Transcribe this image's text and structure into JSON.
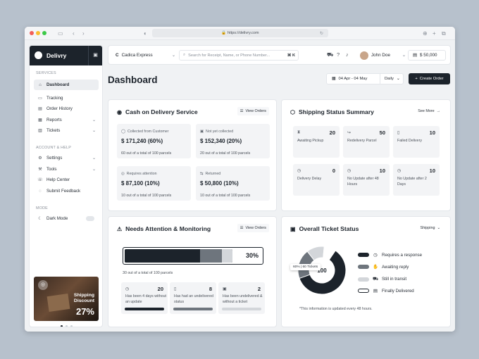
{
  "browser": {
    "url": "https://delivry.com"
  },
  "sidebar": {
    "brand": "Delivry",
    "sections": {
      "services": "SERVICES",
      "account": "ACCOUNT & HELP",
      "mode": "MODE"
    },
    "items": [
      {
        "label": "Dashboard",
        "icon": "home-icon"
      },
      {
        "label": "Tracking",
        "icon": "truck-icon"
      },
      {
        "label": "Order History",
        "icon": "clipboard-icon"
      },
      {
        "label": "Reports",
        "icon": "report-icon"
      },
      {
        "label": "Tickets",
        "icon": "ticket-icon"
      }
    ],
    "account_items": [
      {
        "label": "Settings",
        "icon": "gear-icon"
      },
      {
        "label": "Tools",
        "icon": "tools-icon"
      },
      {
        "label": "Help Center",
        "icon": "help-icon"
      },
      {
        "label": "Submit Feedback",
        "icon": "feedback-icon"
      }
    ],
    "mode_item": "Dark Mode",
    "promo": {
      "line1": "Shipping Discount",
      "line2": "27%"
    }
  },
  "topbar": {
    "company": "Cadica Express",
    "search_placeholder": "Search for Receipt, Name, or Phone Number...",
    "search_shortcut": "⌘ K",
    "user": "John Doe",
    "balance": "$ 50,000"
  },
  "page": {
    "title": "Dashboard",
    "date_range": "04 Apr - 04 May",
    "period": "Daily",
    "create_label": "Create Order"
  },
  "cod": {
    "title": "Cash on Delivery Service",
    "button": "View Orders",
    "tiles": [
      {
        "label": "Collected from Customer",
        "value": "$ 171,240 (60%)",
        "sub": "60 out of a total of 100 parcels"
      },
      {
        "label": "Not yet collected",
        "value": "$ 152,340 (20%)",
        "sub": "20 out of a total of 100 parcels"
      },
      {
        "label": "Requires attention",
        "value": "$ 87,100 (10%)",
        "sub": "10 out of a total of 100 parcels"
      },
      {
        "label": "Returned",
        "value": "$ 50,800 (10%)",
        "sub": "10 out of a total of 100 parcels"
      }
    ]
  },
  "shipping": {
    "title": "Shipping Status Summary",
    "button": "See More",
    "tiles": [
      {
        "count": "20",
        "label": "Awaiting Pickup"
      },
      {
        "count": "50",
        "label": "Redelivery Parcel"
      },
      {
        "count": "10",
        "label": "Failed Delivery"
      },
      {
        "count": "0",
        "label": "Delivery Delay"
      },
      {
        "count": "10",
        "label": "No Update after 48 Hours"
      },
      {
        "count": "10",
        "label": "No Update after 2 Days"
      }
    ]
  },
  "attention": {
    "title": "Needs Attention & Monitoring",
    "button": "View Orders",
    "progress_percent": 30,
    "progress_label": "30%",
    "sub": "30 out of a total of 100 parcels",
    "tiles": [
      {
        "count": "20",
        "label": "Has been 4 days without an update",
        "color": "#1c232b"
      },
      {
        "count": "8",
        "label": "Has had an undelivered status",
        "color": "#6e757d"
      },
      {
        "count": "2",
        "label": "Has been undelivered & without a ticket",
        "color": "#d3d6da"
      }
    ]
  },
  "tickets": {
    "title": "Overall Ticket Status",
    "filter": "Shipping",
    "center_value": "100",
    "tooltip": "60% | 60 Tickets",
    "note": "*This information is updated every 48 hours.",
    "legend": [
      {
        "label": "Requires a response",
        "color": "#1c232b",
        "value": 60
      },
      {
        "label": "Awaiting reply",
        "color": "#6e757d",
        "value": 20
      },
      {
        "label": "Still in transit",
        "color": "#d3d6da",
        "value": 12
      },
      {
        "label": "Finally Delivered",
        "color": "#ffffff",
        "value": 8
      }
    ]
  }
}
